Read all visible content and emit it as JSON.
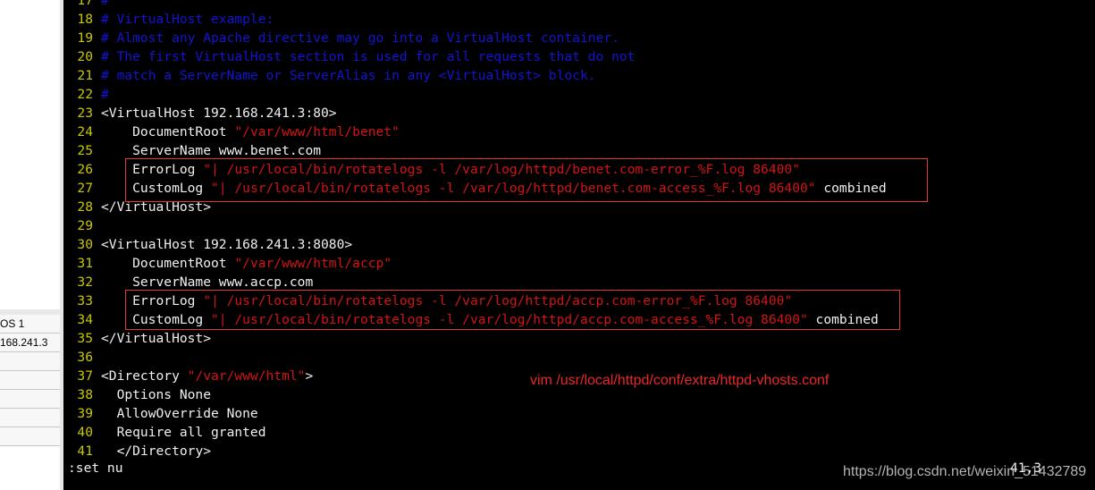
{
  "left_panel": {
    "rows": [
      "OS 1",
      "168.241.3",
      "",
      "",
      "",
      "",
      ""
    ]
  },
  "editor": {
    "lines": [
      {
        "n": "17",
        "segs": [
          {
            "t": "#",
            "c": "comment"
          }
        ]
      },
      {
        "n": "18",
        "segs": [
          {
            "t": "# VirtualHost example:",
            "c": "comment"
          }
        ]
      },
      {
        "n": "19",
        "segs": [
          {
            "t": "# Almost any Apache directive may go into a VirtualHost container.",
            "c": "comment"
          }
        ]
      },
      {
        "n": "20",
        "segs": [
          {
            "t": "# The first VirtualHost section is used for all requests that do not",
            "c": "comment"
          }
        ]
      },
      {
        "n": "21",
        "segs": [
          {
            "t": "# match a ServerName or ServerAlias in any <VirtualHost> block.",
            "c": "comment"
          }
        ]
      },
      {
        "n": "22",
        "segs": [
          {
            "t": "#",
            "c": "comment"
          }
        ]
      },
      {
        "n": "23",
        "segs": [
          {
            "t": "<VirtualHost 192.168.241.3:80>",
            "c": "normal"
          }
        ]
      },
      {
        "n": "24",
        "segs": [
          {
            "t": "    DocumentRoot ",
            "c": "normal"
          },
          {
            "t": "\"/var/www/html/benet\"",
            "c": "string"
          }
        ]
      },
      {
        "n": "25",
        "segs": [
          {
            "t": "    ServerName www.benet.com",
            "c": "normal"
          }
        ]
      },
      {
        "n": "26",
        "segs": [
          {
            "t": "    ErrorLog ",
            "c": "normal"
          },
          {
            "t": "\"| /usr/local/bin/rotatelogs -l /var/log/httpd/benet.com-error_%F.log 86400\"",
            "c": "string"
          }
        ]
      },
      {
        "n": "27",
        "segs": [
          {
            "t": "    CustomLog ",
            "c": "normal"
          },
          {
            "t": "\"| /usr/local/bin/rotatelogs -l /var/log/httpd/benet.com-access_%F.log 86400\"",
            "c": "string"
          },
          {
            "t": " combined",
            "c": "normal"
          }
        ]
      },
      {
        "n": "28",
        "segs": [
          {
            "t": "</VirtualHost>",
            "c": "normal"
          }
        ]
      },
      {
        "n": "29",
        "segs": []
      },
      {
        "n": "30",
        "segs": [
          {
            "t": "<VirtualHost 192.168.241.3:8080>",
            "c": "normal"
          }
        ]
      },
      {
        "n": "31",
        "segs": [
          {
            "t": "    DocumentRoot ",
            "c": "normal"
          },
          {
            "t": "\"/var/www/html/accp\"",
            "c": "string"
          }
        ]
      },
      {
        "n": "32",
        "segs": [
          {
            "t": "    ServerName www.accp.com",
            "c": "normal"
          }
        ]
      },
      {
        "n": "33",
        "segs": [
          {
            "t": "    ErrorLog ",
            "c": "normal"
          },
          {
            "t": "\"| /usr/local/bin/rotatelogs -l /var/log/httpd/accp.com-error_%F.log 86400\"",
            "c": "string"
          }
        ]
      },
      {
        "n": "34",
        "segs": [
          {
            "t": "    CustomLog ",
            "c": "normal"
          },
          {
            "t": "\"| /usr/local/bin/rotatelogs -l /var/log/httpd/accp.com-access_%F.log 86400\"",
            "c": "string"
          },
          {
            "t": " combined",
            "c": "normal"
          }
        ]
      },
      {
        "n": "35",
        "segs": [
          {
            "t": "</VirtualHost>",
            "c": "normal"
          }
        ]
      },
      {
        "n": "36",
        "segs": []
      },
      {
        "n": "37",
        "segs": [
          {
            "t": "<Directory ",
            "c": "normal"
          },
          {
            "t": "\"/var/www/html\"",
            "c": "string"
          },
          {
            "t": ">",
            "c": "normal"
          }
        ]
      },
      {
        "n": "38",
        "segs": [
          {
            "t": "  Options None",
            "c": "normal"
          }
        ]
      },
      {
        "n": "39",
        "segs": [
          {
            "t": "  AllowOverride None",
            "c": "normal"
          }
        ]
      },
      {
        "n": "40",
        "segs": [
          {
            "t": "  Require all granted",
            "c": "normal"
          }
        ]
      },
      {
        "n": "41",
        "segs": [
          {
            "t": "  ",
            "c": "normal"
          },
          {
            "t": "<",
            "c": "cursor"
          },
          {
            "t": "/Directory>",
            "c": "normal"
          }
        ]
      }
    ]
  },
  "status": {
    "command": ":set nu",
    "position": "41,3"
  },
  "annotation": "vim /usr/local/httpd/conf/extra/httpd-vhosts.conf",
  "watermark": "https://blog.csdn.net/weixin_51432789",
  "colors": {
    "comment": "#1414d2",
    "string": "#d21414",
    "line_number": "#c8c800",
    "highlight_box": "#e03838",
    "cursor": "#1ee61e"
  }
}
